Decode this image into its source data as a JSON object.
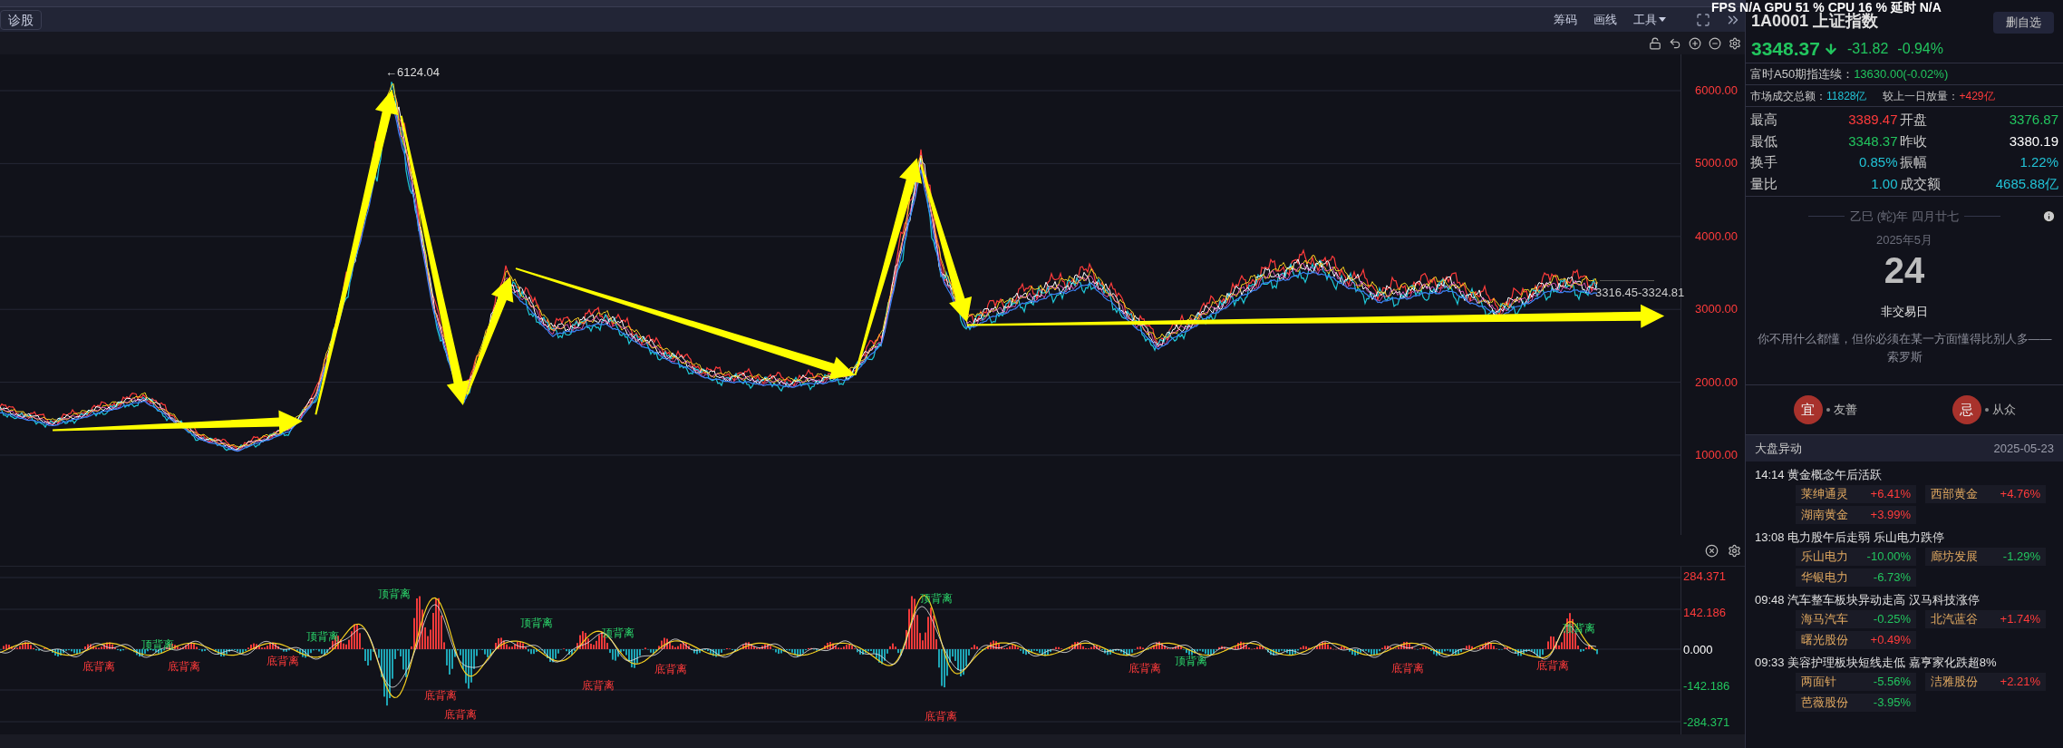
{
  "perf_overlay": "FPS N/A GPU 51 % CPU 16 % 延时 N/A",
  "header": {
    "tab": "诊股",
    "tools": [
      {
        "label": "筹码",
        "dropdown": false
      },
      {
        "label": "画线",
        "dropdown": false
      },
      {
        "label": "工具",
        "dropdown": true
      }
    ]
  },
  "price_chart": {
    "y_axis": [
      "6000.00",
      "5000.00",
      "4000.00",
      "3000.00",
      "2000.00",
      "1000.00"
    ],
    "peak_label": "←6124.04",
    "range_label": "3316.45-3324.81"
  },
  "indicator": {
    "y_axis": [
      {
        "label": "284.371",
        "color": "#ff3b3b"
      },
      {
        "label": "142.186",
        "color": "#ff3b3b"
      },
      {
        "label": "0.000",
        "color": "#ffffff"
      },
      {
        "label": "-142.186",
        "color": "#22c55e"
      },
      {
        "label": "-284.371",
        "color": "#22c55e"
      }
    ],
    "signals": [
      {
        "kind": "top",
        "label": "顶背离"
      },
      {
        "kind": "top",
        "label": "顶背离"
      },
      {
        "kind": "top",
        "label": "顶背离"
      },
      {
        "kind": "top",
        "label": "顶背离"
      },
      {
        "kind": "top",
        "label": "顶背离"
      },
      {
        "kind": "top",
        "label": "顶背离"
      },
      {
        "kind": "top",
        "label": "顶背离"
      },
      {
        "kind": "top",
        "label": "顶背离"
      },
      {
        "kind": "bottom",
        "label": "底背离"
      },
      {
        "kind": "bottom",
        "label": "底背离"
      },
      {
        "kind": "bottom",
        "label": "底背离"
      },
      {
        "kind": "bottom",
        "label": "底背离"
      },
      {
        "kind": "bottom",
        "label": "底背离"
      },
      {
        "kind": "bottom",
        "label": "底背离"
      },
      {
        "kind": "bottom",
        "label": "底背离"
      },
      {
        "kind": "bottom",
        "label": "底背离"
      },
      {
        "kind": "bottom",
        "label": "底背离"
      },
      {
        "kind": "bottom",
        "label": "底背离"
      },
      {
        "kind": "bottom",
        "label": "底背离"
      }
    ]
  },
  "quote": {
    "code": "1A0001",
    "name": "上证指数",
    "button": "删自选",
    "price": "3348.37",
    "change": "-31.82",
    "change_pct": "-0.94%",
    "color": "#22c55e",
    "futures": {
      "label": "富时A50期指连续：",
      "value": "13630.00(-0.02%)"
    },
    "turnover": {
      "label": "市场成交总额：",
      "value": "11828亿",
      "compare_label": "较上一日放量：",
      "compare_value": "+429亿"
    },
    "stats": [
      {
        "label": "最高",
        "value": "3389.47",
        "color": "#ff3b3b"
      },
      {
        "label": "开盘",
        "value": "3376.87",
        "color": "#22c55e"
      },
      {
        "label": "最低",
        "value": "3348.37",
        "color": "#22c55e"
      },
      {
        "label": "昨收",
        "value": "3380.19",
        "color": "#ffffff"
      },
      {
        "label": "换手",
        "value": "0.85%",
        "color": "#22c3d6"
      },
      {
        "label": "振幅",
        "value": "1.22%",
        "color": "#22c3d6"
      },
      {
        "label": "量比",
        "value": "1.00",
        "color": "#22c3d6"
      },
      {
        "label": "成交额",
        "value": "4685.88亿",
        "color": "#22c3d6"
      }
    ]
  },
  "calendar": {
    "lunar": "乙巳 (蛇)年 四月廿七",
    "month": "2025年5月",
    "day": "24",
    "status": "非交易日",
    "quote": "你不用什么都懂，但你必须在某一方面懂得比别人多——索罗斯",
    "good": {
      "mark": "宜",
      "text": "友善"
    },
    "bad": {
      "mark": "忌",
      "text": "从众"
    }
  },
  "market_moves": {
    "title": "大盘异动",
    "date": "2025-05-23",
    "events": [
      {
        "time": "14:14",
        "title": "黄金概念午后活跃",
        "stocks": [
          {
            "name": "莱绅通灵",
            "change": "+6.41%",
            "color": "#ff3b3b"
          },
          {
            "name": "西部黄金",
            "change": "+4.76%",
            "color": "#ff3b3b"
          },
          {
            "name": "湖南黄金",
            "change": "+3.99%",
            "color": "#ff3b3b"
          }
        ]
      },
      {
        "time": "13:08",
        "title": "电力股午后走弱 乐山电力跌停",
        "stocks": [
          {
            "name": "乐山电力",
            "change": "-10.00%",
            "color": "#22c55e"
          },
          {
            "name": "廊坊发展",
            "change": "-1.29%",
            "color": "#22c55e"
          },
          {
            "name": "华银电力",
            "change": "-6.73%",
            "color": "#22c55e"
          }
        ]
      },
      {
        "time": "09:48",
        "title": "汽车整车板块异动走高 汉马科技涨停",
        "stocks": [
          {
            "name": "海马汽车",
            "change": "-0.25%",
            "color": "#22c55e"
          },
          {
            "name": "北汽蓝谷",
            "change": "+1.74%",
            "color": "#ff3b3b"
          },
          {
            "name": "曙光股份",
            "change": "+0.49%",
            "color": "#ff3b3b"
          }
        ]
      },
      {
        "time": "09:33",
        "title": "美容护理板块短线走低 嘉亨家化跌超8%",
        "stocks": [
          {
            "name": "两面针",
            "change": "-5.56%",
            "color": "#22c55e"
          },
          {
            "name": "洁雅股份",
            "change": "+2.21%",
            "color": "#ff3b3b"
          },
          {
            "name": "芭薇股份",
            "change": "-3.95%",
            "color": "#22c55e"
          }
        ]
      }
    ]
  }
}
